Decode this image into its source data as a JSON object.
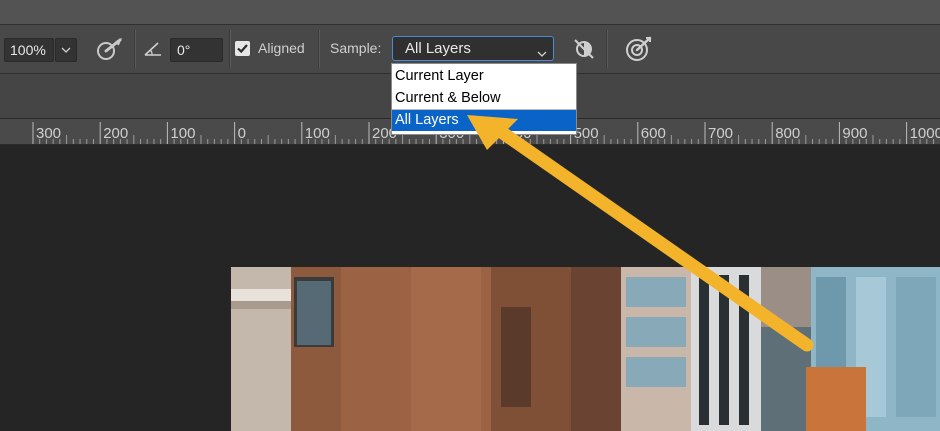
{
  "toolbar": {
    "zoom_value": "100%",
    "angle_value": "0°",
    "aligned_label": "Aligned",
    "aligned_checked": true,
    "sample_label": "Sample:",
    "sample_selected": "All Layers"
  },
  "sample_dropdown": {
    "options": [
      "Current Layer",
      "Current & Below",
      "All Layers"
    ],
    "selected_index": 2
  },
  "ruler": {
    "labels": [
      "300",
      "200",
      "100",
      "0",
      "100",
      "200",
      "300",
      "400",
      "500",
      "600",
      "700",
      "800",
      "900",
      "1000"
    ]
  },
  "colors": {
    "background": "#252525",
    "toolbar": "#484848",
    "selection_blue": "#0a64c8",
    "arrow_yellow": "#f3b32a"
  }
}
